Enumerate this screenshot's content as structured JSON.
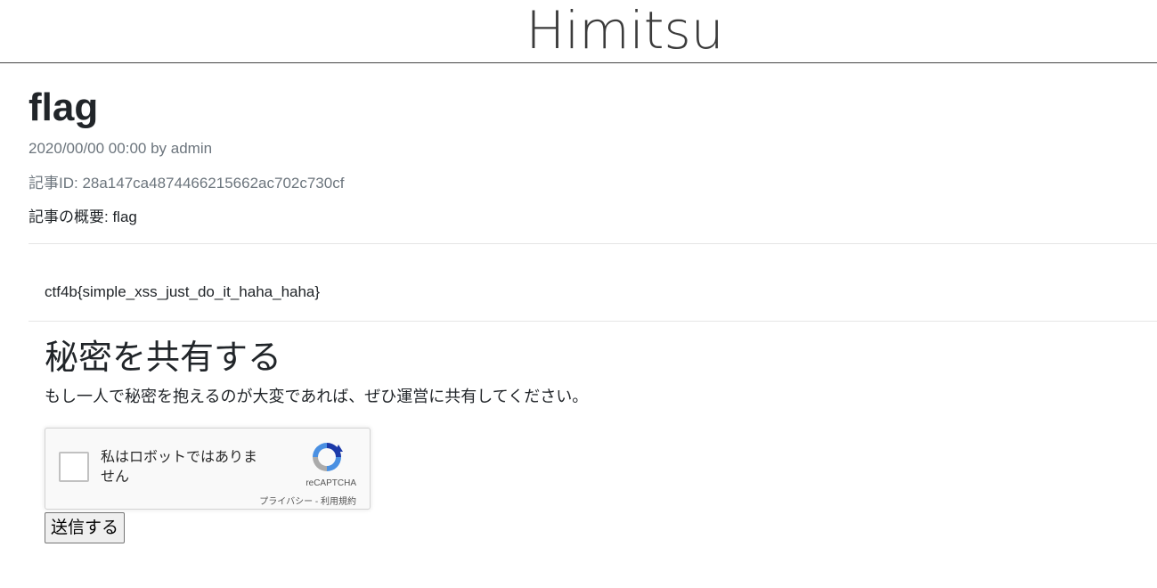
{
  "site": {
    "title": "Himitsu"
  },
  "article": {
    "title": "flag",
    "date_author": "2020/00/00 00:00 by admin",
    "id_line": "記事ID: 28a147ca4874466215662ac702c730cf",
    "summary": "記事の概要: flag",
    "body": "ctf4b{simple_xss_just_do_it_haha_haha}"
  },
  "share": {
    "heading": "秘密を共有する",
    "description": "もし一人で秘密を抱えるのが大変であれば、ぜひ運営に共有してください。",
    "recaptcha": {
      "label": "私はロボットではありません",
      "brand": "reCAPTCHA",
      "privacy": "プライバシー",
      "separator": " - ",
      "terms": "利用規約",
      "icon": "recaptcha-logo-icon"
    },
    "submit_label": "送信する"
  }
}
